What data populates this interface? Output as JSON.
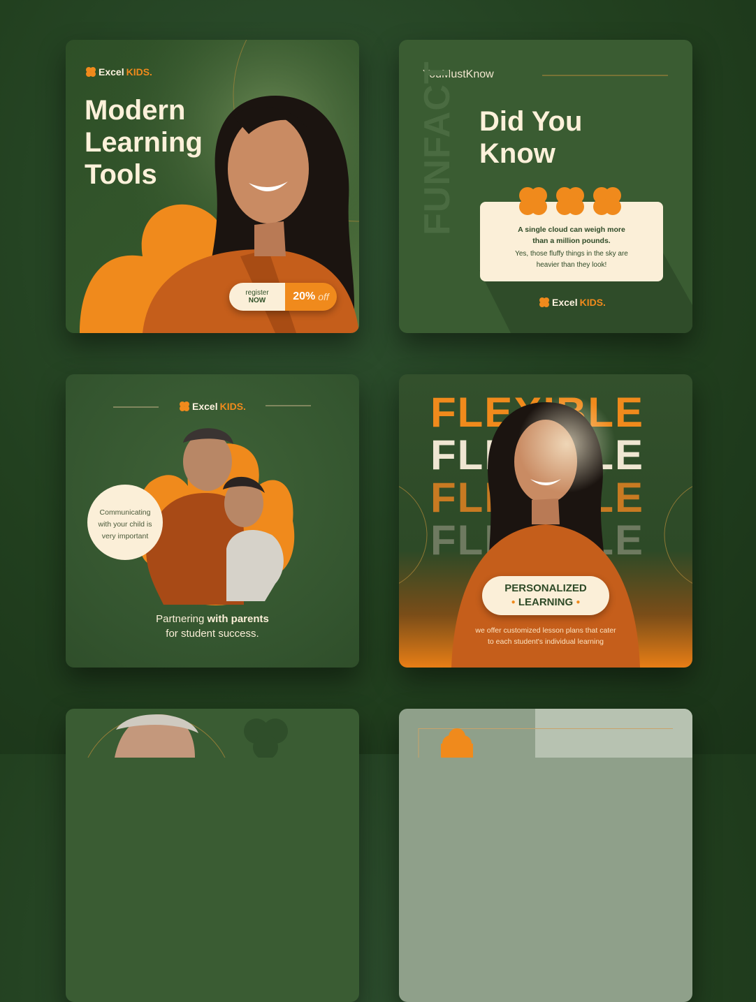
{
  "brand": {
    "part1": "Excel",
    "part2": "KIDS."
  },
  "card1": {
    "headline": [
      "Modern",
      "Learning",
      "Tools"
    ],
    "cta_register": "register",
    "cta_now": "NOW",
    "discount_value": "20%",
    "discount_suffix": "off"
  },
  "card2": {
    "handle": "YouMustKnow",
    "vertical_text": "FUNFACT",
    "headline": [
      "Did You",
      "Know"
    ],
    "fact_bold": [
      "A single cloud can weigh more",
      "than a million pounds."
    ],
    "fact_text": [
      "Yes, those fluffy things in the sky are",
      "heavier than they look!"
    ]
  },
  "card3": {
    "bubble": [
      "Communicating",
      "with your child is",
      "very important"
    ],
    "caption_part1": "Partnering ",
    "caption_bold": "with parents",
    "caption_line2": "for student success."
  },
  "card4": {
    "repeat_word": "FLEXIBLE",
    "badge": [
      "PERSONALIZED",
      "LEARNING"
    ],
    "body": [
      "we offer customized lesson plans that cater",
      "to each student's individual learning"
    ]
  },
  "colors": {
    "orange": "#f08a1c",
    "cream": "#fbefd8",
    "green_dark": "#22401f",
    "green_card": "#3a5c32"
  }
}
